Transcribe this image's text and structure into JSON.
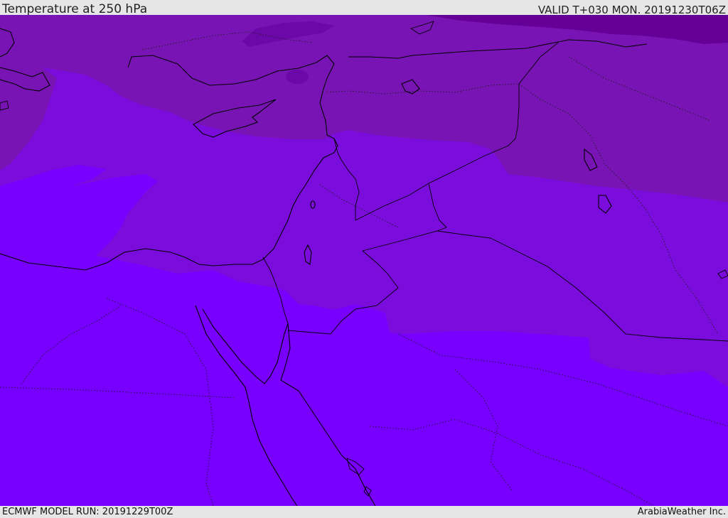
{
  "header": {
    "title": "Temperature at 250 hPa",
    "valid": "VALID T+030 MON. 20191230T06Z"
  },
  "footer": {
    "model_run": "ECMWF MODEL RUN: 20191229T00Z",
    "credit": "ArabiaWeather Inc."
  },
  "map": {
    "colors": {
      "coldest": "#640096",
      "colder": "#7814b4",
      "cold": "#7a0ddc",
      "base": "#7800ff",
      "coastline": "#000000",
      "border": "#1e1e1e"
    }
  }
}
